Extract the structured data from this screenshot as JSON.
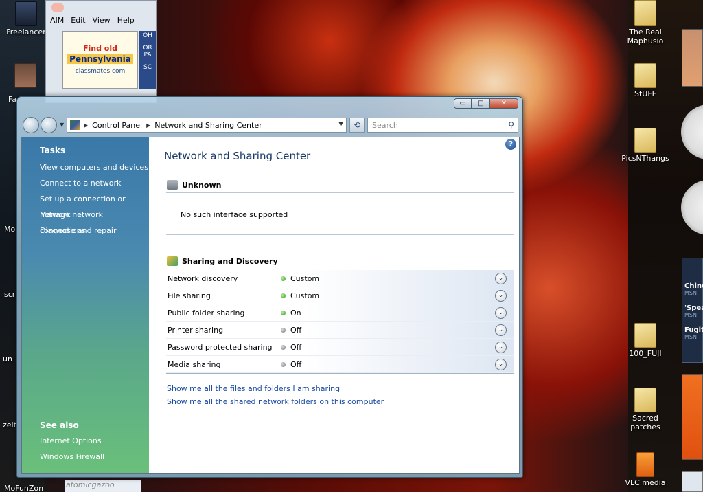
{
  "desktop": {
    "left_icons": [
      {
        "label": "Freelancer"
      },
      {
        "label": "Fa"
      },
      {
        "label": "Mo"
      },
      {
        "label": "scr"
      },
      {
        "label": "un"
      },
      {
        "label": "zeit"
      },
      {
        "label": "MoFunZon"
      }
    ],
    "right_icons": [
      {
        "label": "The Real Maphusio"
      },
      {
        "label": "StUFF"
      },
      {
        "label": "PicsNThangs"
      },
      {
        "label": "100_FUJI"
      },
      {
        "label": "Sacred patches"
      },
      {
        "label": "VLC media"
      }
    ],
    "msn_items": [
      {
        "title": "Chine",
        "sub": "MSN"
      },
      {
        "title": "'Spea",
        "sub": "MSN"
      },
      {
        "title": "Fugiti",
        "sub": "MSN"
      }
    ],
    "aim_field_text": "atomicgazoo"
  },
  "aim": {
    "logo": "AIM",
    "menu": [
      "AIM",
      "Edit",
      "View",
      "Help"
    ],
    "ad": {
      "line1": "Find old",
      "line2": "Pennsylvania",
      "line3": "classmates·com"
    },
    "side": [
      "OH",
      "OR",
      "PA",
      "SC"
    ]
  },
  "window": {
    "controls": {
      "minimize": "▭",
      "maximize": "□",
      "close": "✕"
    },
    "address": {
      "crumbs": [
        "Control Panel",
        "Network and Sharing Center"
      ]
    },
    "search_placeholder": "Search",
    "sidebar": {
      "tasks_heading": "Tasks",
      "tasks": [
        "View computers and devices",
        "Connect to a network",
        "Set up a connection or network",
        "Manage network connections",
        "Diagnose and repair"
      ],
      "see_also_heading": "See also",
      "see_also": [
        "Internet Options",
        "Windows Firewall"
      ]
    },
    "main": {
      "title": "Network and Sharing Center",
      "network_section": "Unknown",
      "network_status": "No such interface supported",
      "sharing_section": "Sharing and Discovery",
      "sharing_rows": [
        {
          "label": "Network discovery",
          "value": "Custom",
          "state": "on"
        },
        {
          "label": "File sharing",
          "value": "Custom",
          "state": "on"
        },
        {
          "label": "Public folder sharing",
          "value": "On",
          "state": "on"
        },
        {
          "label": "Printer sharing",
          "value": "Off",
          "state": "off"
        },
        {
          "label": "Password protected sharing",
          "value": "Off",
          "state": "off"
        },
        {
          "label": "Media sharing",
          "value": "Off",
          "state": "off"
        }
      ],
      "links": [
        "Show me all the files and folders I am sharing",
        "Show me all the shared network folders on this computer"
      ]
    }
  }
}
